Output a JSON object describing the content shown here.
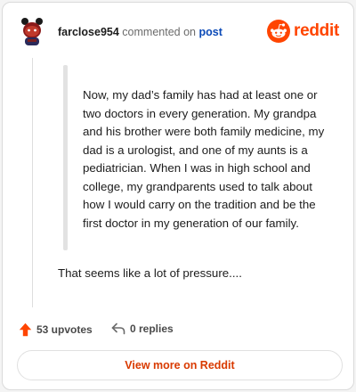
{
  "header": {
    "username": "farclose954",
    "action": "commented on",
    "post_link": "post",
    "brand": "reddit"
  },
  "comment": {
    "quoted_text": "Now, my dad’s family has had at least one or two doctors in every generation. My grandpa and his brother were both family medicine, my dad is a urologist, and one of my aunts is a pediatrician. When I was in high school and college, my grandparents used to talk about how I would carry on the tradition and be the first doctor in my generation of our family.",
    "reply_text": "That seems like a lot of pressure...."
  },
  "stats": {
    "upvotes_label": "53 upvotes",
    "replies_label": "0 replies"
  },
  "footer": {
    "view_more_label": "View more on Reddit"
  },
  "colors": {
    "brand": "#ff4500",
    "upvote": "#ff4500",
    "link": "#0b4ab7",
    "button_text": "#d93a00"
  },
  "icons": {
    "avatar": "snoo-avatar",
    "logo": "reddit-logo-icon",
    "upvote": "upvote-arrow-icon",
    "reply": "reply-arrow-icon"
  }
}
